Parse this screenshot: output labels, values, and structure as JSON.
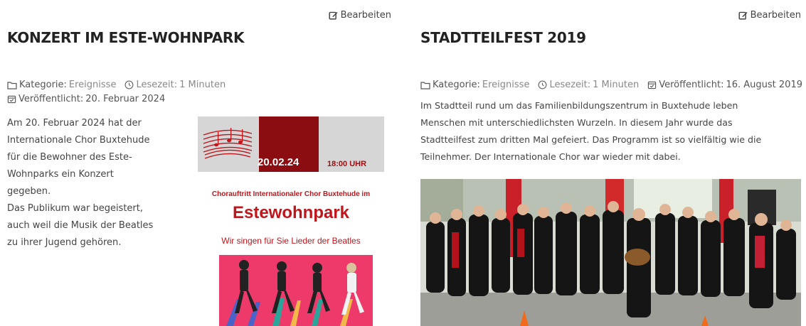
{
  "articles": [
    {
      "edit_label": "Bearbeiten",
      "title": "KONZERT IM ESTE-WOHNPARK",
      "category_label": "Kategorie:",
      "category_value": "Ereignisse",
      "reading_label": "Lesezeit:",
      "reading_value": "1 Minuten",
      "published_label": "Veröffentlicht:",
      "published_value": "20. Februar 2024",
      "body_lines": [
        "Am 20. Februar 2024 hat der",
        "Internationale Chor Buxtehude",
        "für die Bewohner des Este-",
        "Wohnparks ein Konzert",
        "gegeben.",
        "Das Publikum war begeistert,",
        "auch weil die Musik der Beatles",
        "zu ihrer Jugend gehören."
      ],
      "poster": {
        "date": "20.02.24",
        "time": "18:00 UHR",
        "line1": "Chorauftritt Internationaler Chor Buxtehude im",
        "line2": "Estewohnpark",
        "line3": "Wir singen für Sie Lieder der Beatles"
      }
    },
    {
      "edit_label": "Bearbeiten",
      "title": "STADTTEILFEST 2019",
      "category_label": "Kategorie:",
      "category_value": "Ereignisse",
      "reading_label": "Lesezeit:",
      "reading_value": "1 Minuten",
      "published_label": "Veröffentlicht:",
      "published_value": "16. August 2019",
      "body_lines": [
        "Im Stadtteil rund um das Familienbildungszentrum in Buxtehude leben",
        "Menschen mit unterschiedlichsten Wurzeln. In diesem Jahr wurde das",
        "Stadtteilfest zum dritten Mal gefeiert. Das Programm ist so vielfältig wie die",
        "Teilnehmer. Der Internationale Chor war wieder mit dabei."
      ]
    }
  ],
  "icons": {
    "edit": "pencil-square-icon",
    "category": "folder-icon",
    "reading": "clock-icon",
    "published": "calendar-check-icon"
  },
  "colors": {
    "poster_red": "#8b0d12",
    "poster_text_red": "#c0151b",
    "poster_pink": "#ee3a6a"
  }
}
